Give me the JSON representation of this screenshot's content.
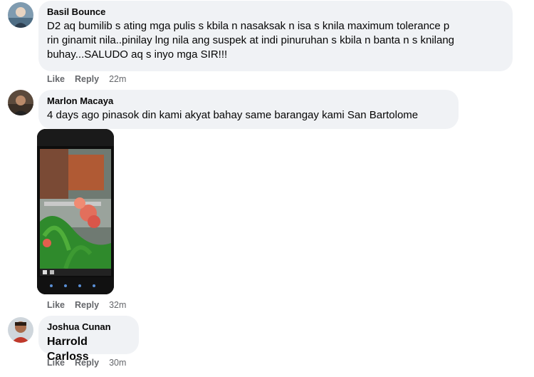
{
  "comments": [
    {
      "author": "Basil Bounce",
      "text_lines": [
        "D2 aq bumilib s ating mga pulis s kbila n nasaksak n isa s knila maximum tolerance p",
        "rin ginamit nila..pinilay lng nila ang suspek at indi pinuruhan s kbila n banta n s knilang",
        "buhay...SALUDO aq s inyo mga SIR!!!"
      ],
      "like": "Like",
      "reply": "Reply",
      "time": "22m"
    },
    {
      "author": "Marlon Macaya",
      "text_lines": [
        "4 days ago pinasok din kami akyat bahay same barangay kami San Bartolome"
      ],
      "like": "Like",
      "reply": "Reply",
      "time": "32m"
    },
    {
      "author": "Joshua Cunan",
      "text_lines": [
        "Harrold Carloss"
      ],
      "like": "Like",
      "reply": "Reply",
      "time": "30m"
    }
  ],
  "colors": {
    "bubble": "#f0f2f5",
    "meta": "#65676b",
    "text": "#050505"
  }
}
